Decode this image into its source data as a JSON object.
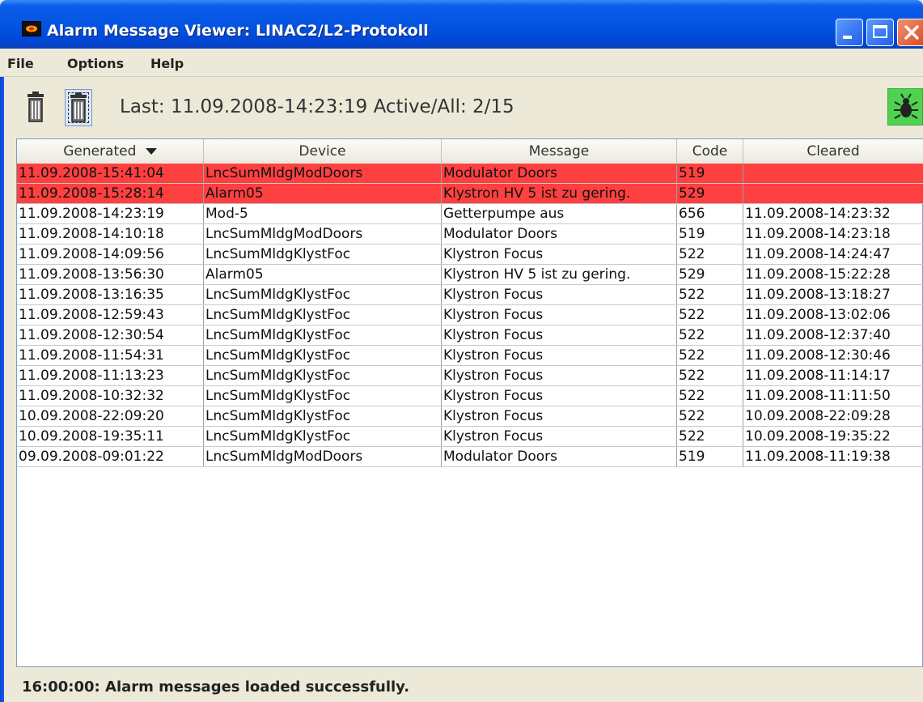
{
  "window": {
    "title": "Alarm Message Viewer: LINAC2/L2-Protokoll",
    "controls": [
      "minimize-icon",
      "maximize-icon",
      "close-icon"
    ]
  },
  "menu": {
    "file": "File",
    "options": "Options",
    "help": "Help"
  },
  "toolbar": {
    "status": "Last: 11.09.2008-14:23:19   Active/All: 2/15",
    "icons": [
      "trash-icon",
      "trash-dashed-icon",
      "bug-icon"
    ]
  },
  "table": {
    "columns": [
      "Generated",
      "Device",
      "Message",
      "Code",
      "Cleared"
    ],
    "sort_icon": "sort-descending-icon",
    "active_color": "#ff4040",
    "rows": [
      {
        "generated": "11.09.2008-15:41:04",
        "device": "LncSumMldgModDoors",
        "message": "Modulator Doors",
        "code": "519",
        "cleared": "",
        "active": true
      },
      {
        "generated": "11.09.2008-15:28:14",
        "device": "Alarm05",
        "message": "Klystron HV 5 ist zu gering.",
        "code": "529",
        "cleared": "",
        "active": true
      },
      {
        "generated": "11.09.2008-14:23:19",
        "device": "Mod-5",
        "message": "Getterpumpe aus",
        "code": "656",
        "cleared": "11.09.2008-14:23:32",
        "active": false
      },
      {
        "generated": "11.09.2008-14:10:18",
        "device": "LncSumMldgModDoors",
        "message": "Modulator Doors",
        "code": "519",
        "cleared": "11.09.2008-14:23:18",
        "active": false
      },
      {
        "generated": "11.09.2008-14:09:56",
        "device": "LncSumMldgKlystFoc",
        "message": "Klystron Focus",
        "code": "522",
        "cleared": "11.09.2008-14:24:47",
        "active": false
      },
      {
        "generated": "11.09.2008-13:56:30",
        "device": "Alarm05",
        "message": "Klystron HV 5 ist zu gering.",
        "code": "529",
        "cleared": "11.09.2008-15:22:28",
        "active": false
      },
      {
        "generated": "11.09.2008-13:16:35",
        "device": "LncSumMldgKlystFoc",
        "message": "Klystron Focus",
        "code": "522",
        "cleared": "11.09.2008-13:18:27",
        "active": false
      },
      {
        "generated": "11.09.2008-12:59:43",
        "device": "LncSumMldgKlystFoc",
        "message": "Klystron Focus",
        "code": "522",
        "cleared": "11.09.2008-13:02:06",
        "active": false
      },
      {
        "generated": "11.09.2008-12:30:54",
        "device": "LncSumMldgKlystFoc",
        "message": "Klystron Focus",
        "code": "522",
        "cleared": "11.09.2008-12:37:40",
        "active": false
      },
      {
        "generated": "11.09.2008-11:54:31",
        "device": "LncSumMldgKlystFoc",
        "message": "Klystron Focus",
        "code": "522",
        "cleared": "11.09.2008-12:30:46",
        "active": false
      },
      {
        "generated": "11.09.2008-11:13:23",
        "device": "LncSumMldgKlystFoc",
        "message": "Klystron Focus",
        "code": "522",
        "cleared": "11.09.2008-11:14:17",
        "active": false
      },
      {
        "generated": "11.09.2008-10:32:32",
        "device": "LncSumMldgKlystFoc",
        "message": "Klystron Focus",
        "code": "522",
        "cleared": "11.09.2008-11:11:50",
        "active": false
      },
      {
        "generated": "10.09.2008-22:09:20",
        "device": "LncSumMldgKlystFoc",
        "message": "Klystron Focus",
        "code": "522",
        "cleared": "10.09.2008-22:09:28",
        "active": false
      },
      {
        "generated": "10.09.2008-19:35:11",
        "device": "LncSumMldgKlystFoc",
        "message": "Klystron Focus",
        "code": "522",
        "cleared": "10.09.2008-19:35:22",
        "active": false
      },
      {
        "generated": "09.09.2008-09:01:22",
        "device": "LncSumMldgModDoors",
        "message": "Modulator Doors",
        "code": "519",
        "cleared": "11.09.2008-11:19:38",
        "active": false
      }
    ]
  },
  "footer": {
    "message": "16:00:00: Alarm messages loaded successfully."
  }
}
